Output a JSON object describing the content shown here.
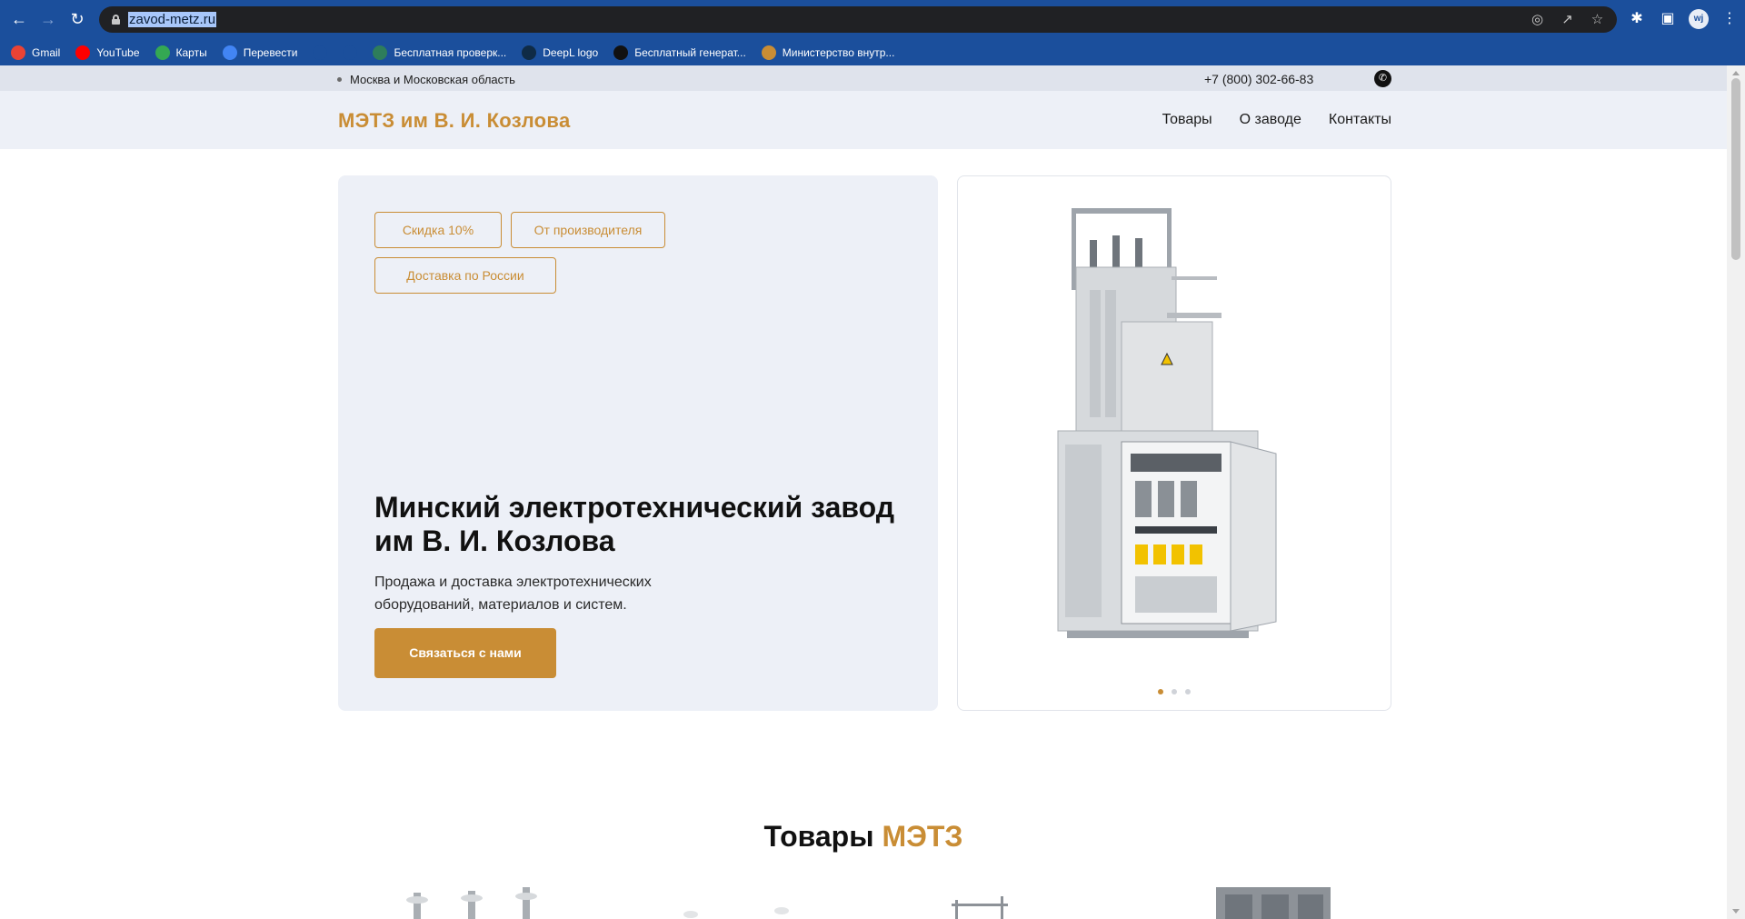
{
  "browser": {
    "url": "zavod-metz.ru",
    "back_icon": "arrow-left-icon",
    "forward_icon": "arrow-right-icon",
    "reload_icon": "reload-icon",
    "profile_initials": "wj",
    "bookmarks": [
      {
        "label": "Gmail",
        "icon": "gmail-icon",
        "color": "#ea4335"
      },
      {
        "label": "YouTube",
        "icon": "youtube-icon",
        "color": "#ff0000"
      },
      {
        "label": "Карты",
        "icon": "maps-icon",
        "color": "#34a853"
      },
      {
        "label": "Перевести",
        "icon": "translate-icon",
        "color": "#4285f4"
      },
      {
        "label": "",
        "icon": "globe-icon",
        "color": "#1b4f9c"
      },
      {
        "label": "",
        "icon": "globe-icon",
        "color": "#1b4f9c"
      },
      {
        "label": "Бесплатная проверк...",
        "icon": "check-icon",
        "color": "#2e7d5b"
      },
      {
        "label": "DeepL logo",
        "icon": "deepl-icon",
        "color": "#0f2b46"
      },
      {
        "label": "Бесплатный генерат...",
        "icon": "generator-icon",
        "color": "#111111"
      },
      {
        "label": "Министерство внутр...",
        "icon": "emblem-icon",
        "color": "#c98d35"
      }
    ]
  },
  "topbar": {
    "region": "Москва и Московская область",
    "phone": "+7 (800) 302-66-83"
  },
  "header": {
    "logo": "МЭТЗ им В. И. Козлова",
    "nav": [
      "Товары",
      "О заводе",
      "Контакты"
    ]
  },
  "hero": {
    "badges": [
      "Скидка 10%",
      "От производителя",
      "Доставка по России"
    ],
    "title": "Минский электротехнический завод им В. И. Козлова",
    "subtitle": "Продажа и доставка электротехнических оборудований, материалов и систем.",
    "cta": "Связаться с нами",
    "slides_total": 3,
    "slide_active": 1
  },
  "products": {
    "title_main": "Товары",
    "title_accent": "МЭТЗ"
  },
  "colors": {
    "accent": "#c98d35",
    "chrome": "#1b4f9c",
    "panel": "#edf0f7"
  }
}
